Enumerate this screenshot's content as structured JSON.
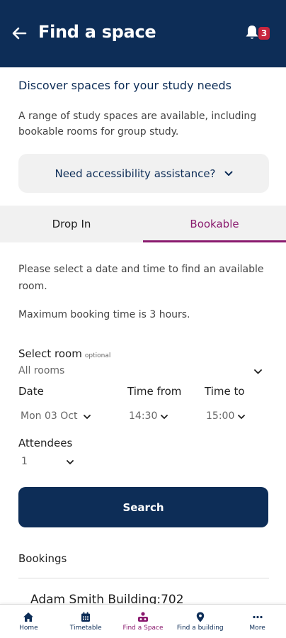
{
  "header": {
    "title": "Find a space",
    "notification_count": "3"
  },
  "intro": {
    "title": "Discover spaces for your study needs",
    "text": "A range of study spaces are available, including bookable rooms for group study."
  },
  "accessibility": {
    "label": "Need accessibility assistance?"
  },
  "tabs": [
    {
      "label": "Drop In"
    },
    {
      "label": "Bookable"
    }
  ],
  "active_tab": "Bookable",
  "info": {
    "line1": "Please select a date and time to find an available room.",
    "line2": "Maximum booking time is 3 hours."
  },
  "form": {
    "select_room_label": "Select room",
    "optional_label": "optional",
    "room_value": "All rooms",
    "date_label": "Date",
    "date_value": "Mon 03 Oct",
    "time_from_label": "Time from",
    "time_from_value": "14:30",
    "time_to_label": "Time to",
    "time_to_value": "15:00",
    "attendees_label": "Attendees",
    "attendees_value": "1",
    "search_label": "Search"
  },
  "bookings": {
    "title": "Bookings",
    "items": [
      "Adam Smith Building:702"
    ]
  },
  "nav": [
    {
      "label": "Home",
      "icon": "home-icon"
    },
    {
      "label": "Timetable",
      "icon": "calendar-icon"
    },
    {
      "label": "Find a Space",
      "icon": "people-icon"
    },
    {
      "label": "Find a building",
      "icon": "location-pin-icon"
    },
    {
      "label": "More",
      "icon": "more-icon"
    }
  ],
  "colors": {
    "primary": "#0d2d57",
    "accent": "#8a1a6e",
    "badge": "#c8263d"
  }
}
